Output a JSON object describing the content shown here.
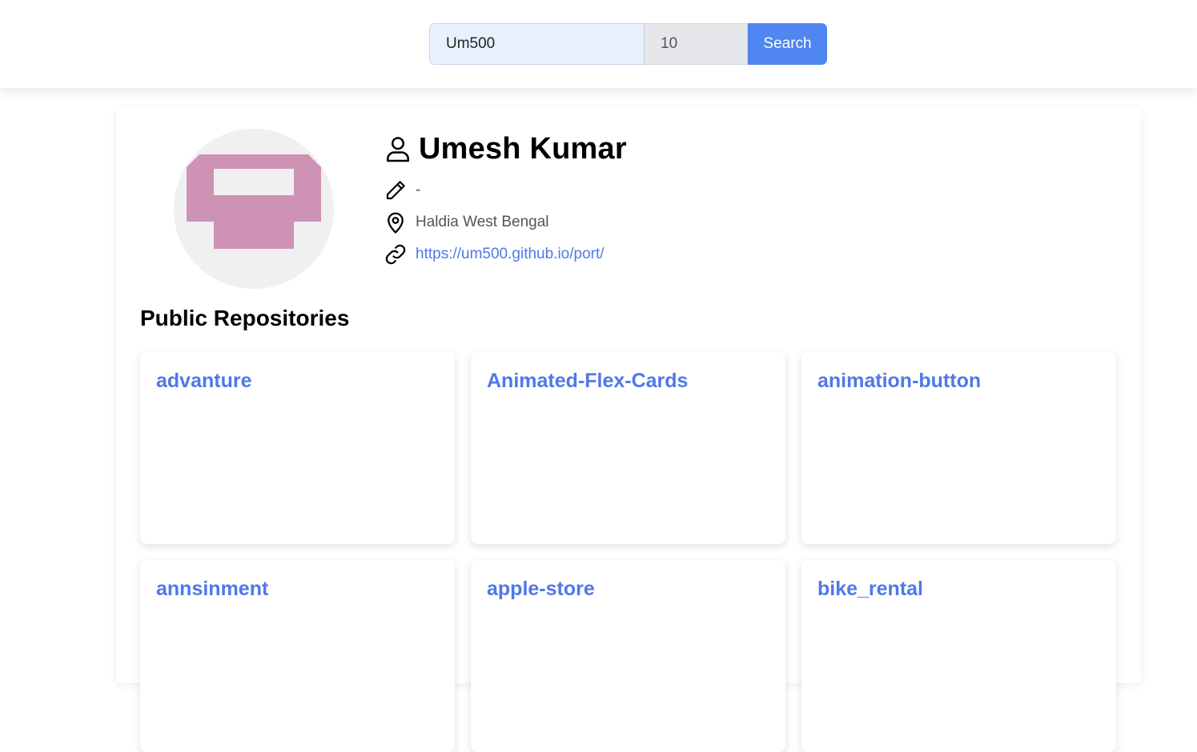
{
  "search": {
    "username_value": "Um500",
    "count_value": "10",
    "button_label": "Search"
  },
  "profile": {
    "name": "Umesh Kumar",
    "bio": "-",
    "location": "Haldia West Bengal",
    "website": "https://um500.github.io/port/",
    "avatar_colors": {
      "background": "#f0f0f0",
      "glyph": "#cd92b4"
    }
  },
  "repositories": {
    "title": "Public Repositories",
    "items": [
      {
        "name": "advanture"
      },
      {
        "name": "Animated-Flex-Cards"
      },
      {
        "name": "animation-button"
      },
      {
        "name": "annsinment"
      },
      {
        "name": "apple-store"
      },
      {
        "name": "bike_rental"
      }
    ]
  },
  "colors": {
    "accent": "#4f86f0",
    "link": "#4f78e8",
    "input_bg": "#e8f0fe"
  },
  "icons": [
    "user-icon",
    "pencil-icon",
    "location-pin-icon",
    "link-icon"
  ]
}
